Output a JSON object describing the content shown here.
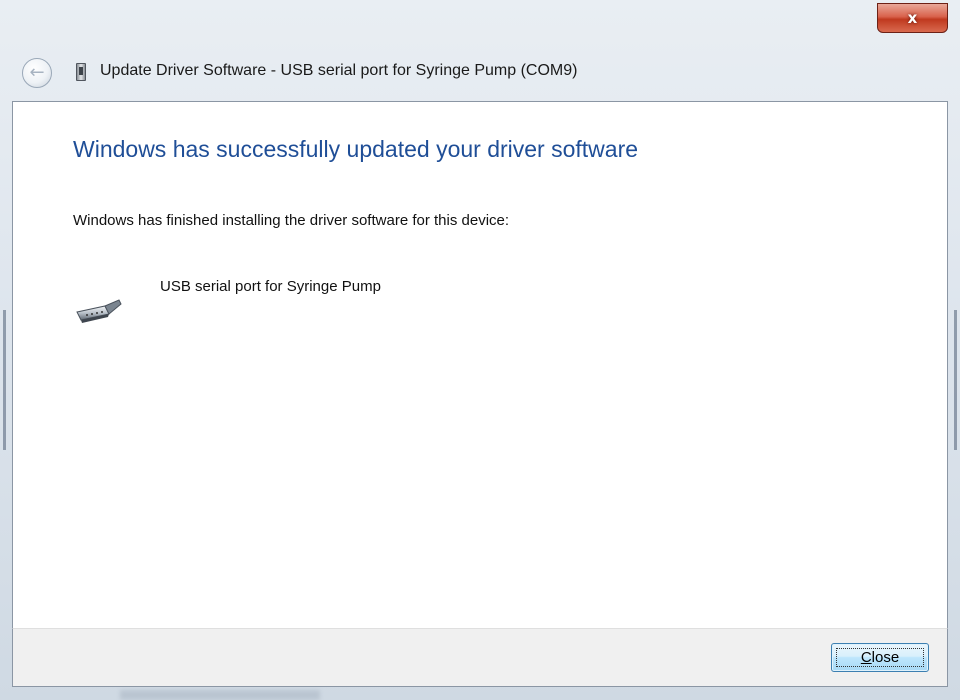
{
  "window": {
    "title": "Update Driver Software - USB serial port for Syringe Pump (COM9)",
    "close_glyph": "x",
    "back_icon": "back-arrow-icon",
    "title_icon": "usb-port-icon"
  },
  "content": {
    "heading": "Windows has successfully updated your driver software",
    "message": "Windows has finished installing the driver software for this device:",
    "device_name": "USB serial port for Syringe Pump",
    "device_icon": "serial-port-icon"
  },
  "footer": {
    "close_mnemonic": "C",
    "close_rest": "lose"
  },
  "colors": {
    "heading": "#1f4e97",
    "close_button_border": "#3c7fb1",
    "caption_close": "#c0391f"
  }
}
